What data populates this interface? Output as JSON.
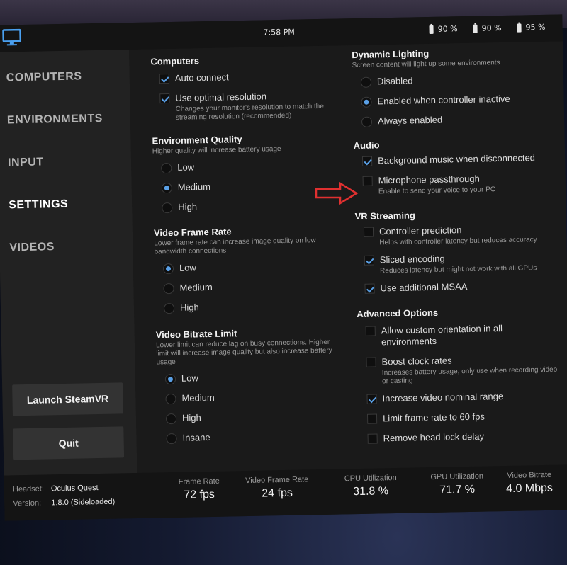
{
  "topbar": {
    "time": "7:58 PM",
    "batteries": [
      "90 %",
      "90 %",
      "95 %"
    ],
    "logo_icon": "monitor-icon"
  },
  "sidebar": {
    "items": [
      {
        "label": "COMPUTERS"
      },
      {
        "label": "ENVIRONMENTS"
      },
      {
        "label": "INPUT"
      },
      {
        "label": "SETTINGS",
        "active": true
      },
      {
        "label": "VIDEOS"
      }
    ],
    "launch_button": "Launch SteamVR",
    "quit_button": "Quit"
  },
  "settings": {
    "computers": {
      "title": "Computers",
      "auto_connect": "Auto connect",
      "optimal_resolution": "Use optimal resolution",
      "optimal_resolution_desc": "Changes your monitor's resolution to match the streaming resolution (recommended)"
    },
    "environment_quality": {
      "title": "Environment Quality",
      "desc": "Higher quality will increase battery usage",
      "options": [
        "Low",
        "Medium",
        "High"
      ],
      "selected": "Medium"
    },
    "video_frame_rate": {
      "title": "Video Frame Rate",
      "desc": "Lower frame rate can increase image quality on low bandwidth connections",
      "options": [
        "Low",
        "Medium",
        "High"
      ],
      "selected": "Low"
    },
    "video_bitrate_limit": {
      "title": "Video Bitrate Limit",
      "desc": "Lower limit can reduce lag on busy connections. Higher limit will increase image quality but also increase battery usage",
      "options": [
        "Low",
        "Medium",
        "High",
        "Insane"
      ],
      "selected": "Low"
    },
    "dynamic_lighting": {
      "title": "Dynamic Lighting",
      "desc": "Screen content will light up some environments",
      "options": [
        "Disabled",
        "Enabled when controller inactive",
        "Always enabled"
      ],
      "selected": "Enabled when controller inactive"
    },
    "audio": {
      "title": "Audio",
      "background_music": "Background music when disconnected",
      "mic_passthrough": "Microphone passthrough",
      "mic_passthrough_desc": "Enable to send your voice to your PC"
    },
    "vr_streaming": {
      "title": "VR Streaming",
      "controller_prediction": "Controller prediction",
      "controller_prediction_desc": "Helps with controller latency but reduces accuracy",
      "sliced_encoding": "Sliced encoding",
      "sliced_encoding_desc": "Reduces latency but might not work with all GPUs",
      "msaa": "Use additional MSAA"
    },
    "advanced": {
      "title": "Advanced Options",
      "custom_orientation": "Allow custom orientation in all environments",
      "boost_clock": "Boost clock rates",
      "boost_clock_desc": "Increases battery usage, only use when recording video or casting",
      "nominal_range": "Increase video nominal range",
      "limit_fps": "Limit frame rate to 60 fps",
      "head_lock": "Remove head lock delay"
    }
  },
  "footer": {
    "headset_label": "Headset:",
    "headset_value": "Oculus Quest",
    "version_label": "Version:",
    "version_value": "1.8.0 (Sideloaded)",
    "stats": [
      {
        "label": "Frame Rate",
        "value": "72 fps"
      },
      {
        "label": "Video Frame Rate",
        "value": "24 fps"
      },
      {
        "label": "CPU Utilization",
        "value": "31.8 %"
      },
      {
        "label": "GPU Utilization",
        "value": "71.7 %"
      },
      {
        "label": "Video Bitrate",
        "value": "4.0 Mbps"
      }
    ]
  },
  "annotation": {
    "arrow_icon": "red-arrow-icon",
    "arrow_color": "#e03030"
  },
  "colors": {
    "accent": "#5aa0e6",
    "panel": "#1b1b1b",
    "sidebar": "#222222"
  }
}
